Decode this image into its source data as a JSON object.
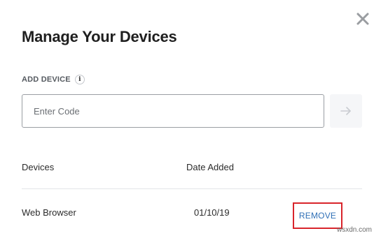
{
  "dialog": {
    "title": "Manage Your Devices",
    "close_icon": "close-icon"
  },
  "add_device": {
    "label": "ADD DEVICE",
    "info_icon": "info-icon",
    "info_glyph": "i",
    "input_value": "",
    "input_placeholder": "Enter Code",
    "submit_icon": "arrow-right-icon"
  },
  "devices_table": {
    "headers": [
      "Devices",
      "Date Added"
    ],
    "rows": [
      {
        "device": "Web Browser",
        "date_added": "01/10/19",
        "action_label": "REMOVE"
      }
    ]
  },
  "watermark": "wsxdn.com",
  "colors": {
    "highlight_border": "#d8242b",
    "link": "#2f6fb6",
    "input_border": "#9a9ea3",
    "submit_bg": "#f5f6f8"
  }
}
